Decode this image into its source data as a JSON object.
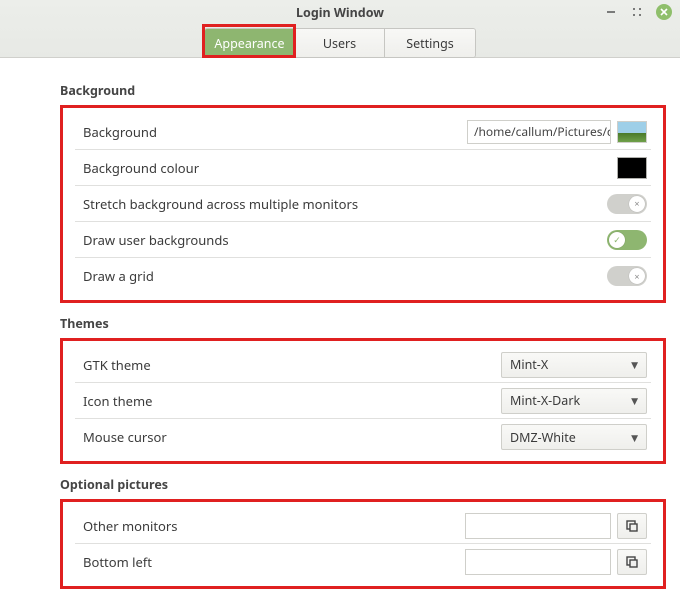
{
  "window": {
    "title": "Login Window"
  },
  "tabs": {
    "appearance": "Appearance",
    "users": "Users",
    "settings": "Settings"
  },
  "sections": {
    "background": {
      "title": "Background",
      "rows": {
        "background_label": "Background",
        "background_path": "/home/callum/Pictures/ca",
        "colour_label": "Background colour",
        "colour_value": "#000000",
        "stretch_label": "Stretch background across multiple monitors",
        "stretch_on": false,
        "draw_user_label": "Draw user backgrounds",
        "draw_user_on": true,
        "draw_grid_label": "Draw a grid",
        "draw_grid_on": false
      }
    },
    "themes": {
      "title": "Themes",
      "rows": {
        "gtk_label": "GTK theme",
        "gtk_value": "Mint-X",
        "icon_label": "Icon theme",
        "icon_value": "Mint-X-Dark",
        "cursor_label": "Mouse cursor",
        "cursor_value": "DMZ-White"
      }
    },
    "optional": {
      "title": "Optional pictures",
      "rows": {
        "other_label": "Other monitors",
        "other_value": "",
        "bottom_label": "Bottom left",
        "bottom_value": ""
      }
    }
  }
}
